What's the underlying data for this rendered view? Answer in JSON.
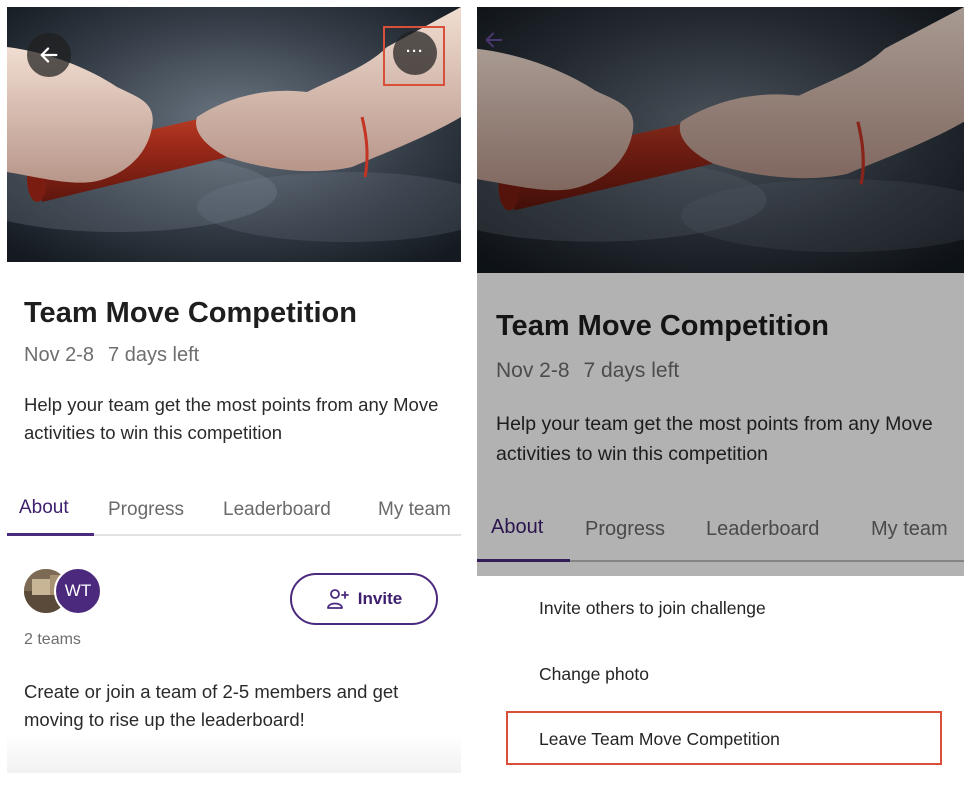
{
  "challenge": {
    "title": "Team Move Competition",
    "dates": "Nov 2-8",
    "days_left": "7 days left",
    "description": "Help your team get the most points from any Move activities to win this competition"
  },
  "tabs": [
    {
      "label": "About",
      "active": true
    },
    {
      "label": "Progress",
      "active": false
    },
    {
      "label": "Leaderboard",
      "active": false
    },
    {
      "label": "My team",
      "active": false
    }
  ],
  "about": {
    "avatar_initials": "WT",
    "invite_label": "Invite",
    "teams_count": "2 teams",
    "text": "Create or join a team of 2-5 members and get moving to rise up the leaderboard!"
  },
  "header": {
    "back_icon": "arrow-left-icon",
    "more_label": "···",
    "more_icon": "more-horizontal-icon"
  },
  "menu": {
    "items": [
      {
        "label": "Invite others to join challenge"
      },
      {
        "label": "Change photo"
      },
      {
        "label": "Leave Team Move Competition"
      }
    ]
  },
  "colors": {
    "accent": "#4a2a7e",
    "highlight": "#d9503a"
  }
}
